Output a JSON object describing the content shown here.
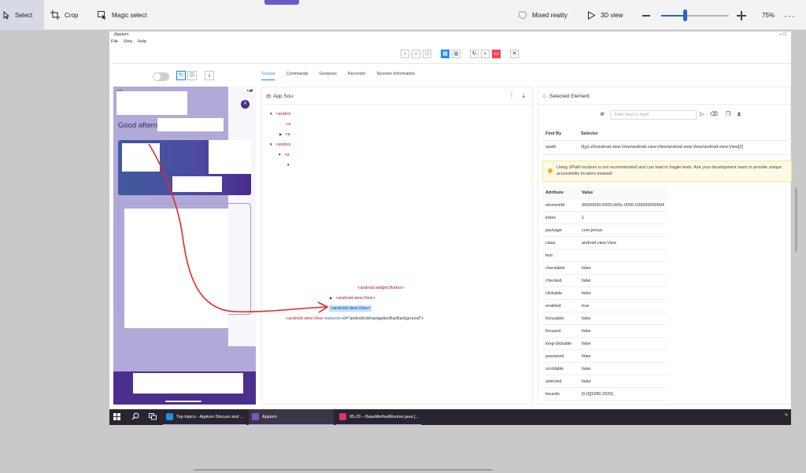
{
  "editor": {
    "tools": {
      "select": "Select",
      "crop": "Crop",
      "magic_select": "Magic select",
      "mixed_reality": "Mixed reality",
      "view_3d": "3D view"
    },
    "zoom_level": "75%",
    "zoom_fraction": 0.33,
    "more": "···",
    "accent_color": "#2468c9"
  },
  "appium": {
    "title": "Appium",
    "menu": [
      "File",
      "View",
      "Help"
    ],
    "window_controls": "–  □",
    "tabs": [
      "Source",
      "Commands",
      "Gestures",
      "Recorder",
      "Session Information"
    ],
    "device": {
      "status_time": "1:41",
      "avatar_letter": "A",
      "greeting": "Good afternoo"
    },
    "source_panel": {
      "title": "App Sou",
      "nodes": {
        "n1": "<androi",
        "n2": "<a",
        "n3": "<a",
        "n4": "<androi",
        "n5": "<a",
        "n6": "<android.widget.Button>",
        "n7": "<android.view.View>",
        "n8": "<android.view.View>",
        "n9_tag": "<android.view.View",
        "n9_attr": "resource-id",
        "n9_val": "=\"android:id/navigationBarBackground\">"
      }
    },
    "selected_panel": {
      "title": "Selected Element",
      "keys_placeholder": "Enter Keys to Send",
      "find_by_header": "Find By",
      "selector_header": "Selector",
      "find_by": "xpath",
      "selector": "//[g1.z0/android.view.View/android.view.View/android.view.View/android.view.View[2]",
      "warning_line1": "Using XPath locators is not recommended and can lead to fragile tests. Ask your development team to provide unique",
      "warning_line2": "accessibility locators instead!",
      "attr_header": "Attribute",
      "value_header": "Value",
      "attributes": [
        {
          "k": "elementId",
          "v": "00000000-0000-000c-0000-039000000004"
        },
        {
          "k": "index",
          "v": "1"
        },
        {
          "k": "package",
          "v": "com.jenius"
        },
        {
          "k": "class",
          "v": "android.view.View"
        },
        {
          "k": "text",
          "v": ""
        },
        {
          "k": "checkable",
          "v": "false"
        },
        {
          "k": "checked",
          "v": "false"
        },
        {
          "k": "clickable",
          "v": "false"
        },
        {
          "k": "enabled",
          "v": "true"
        },
        {
          "k": "focusable",
          "v": "false"
        },
        {
          "k": "focused",
          "v": "false"
        },
        {
          "k": "long-clickable",
          "v": "false"
        },
        {
          "k": "password",
          "v": "false"
        },
        {
          "k": "scrollable",
          "v": "false"
        },
        {
          "k": "selected",
          "v": "false"
        },
        {
          "k": "bounds",
          "v": "[0,0][1080,2920]"
        }
      ]
    }
  },
  "taskbar": {
    "apps": [
      {
        "label": "Top topics - Appium Discuss and ...",
        "color": "#1f8fe6"
      },
      {
        "label": "Appium",
        "color": "#7a5ab8"
      },
      {
        "label": "05-23 – BaseMethodRunner.java [...",
        "color": "#e0336c"
      }
    ],
    "tray": "ᵌ‹"
  }
}
